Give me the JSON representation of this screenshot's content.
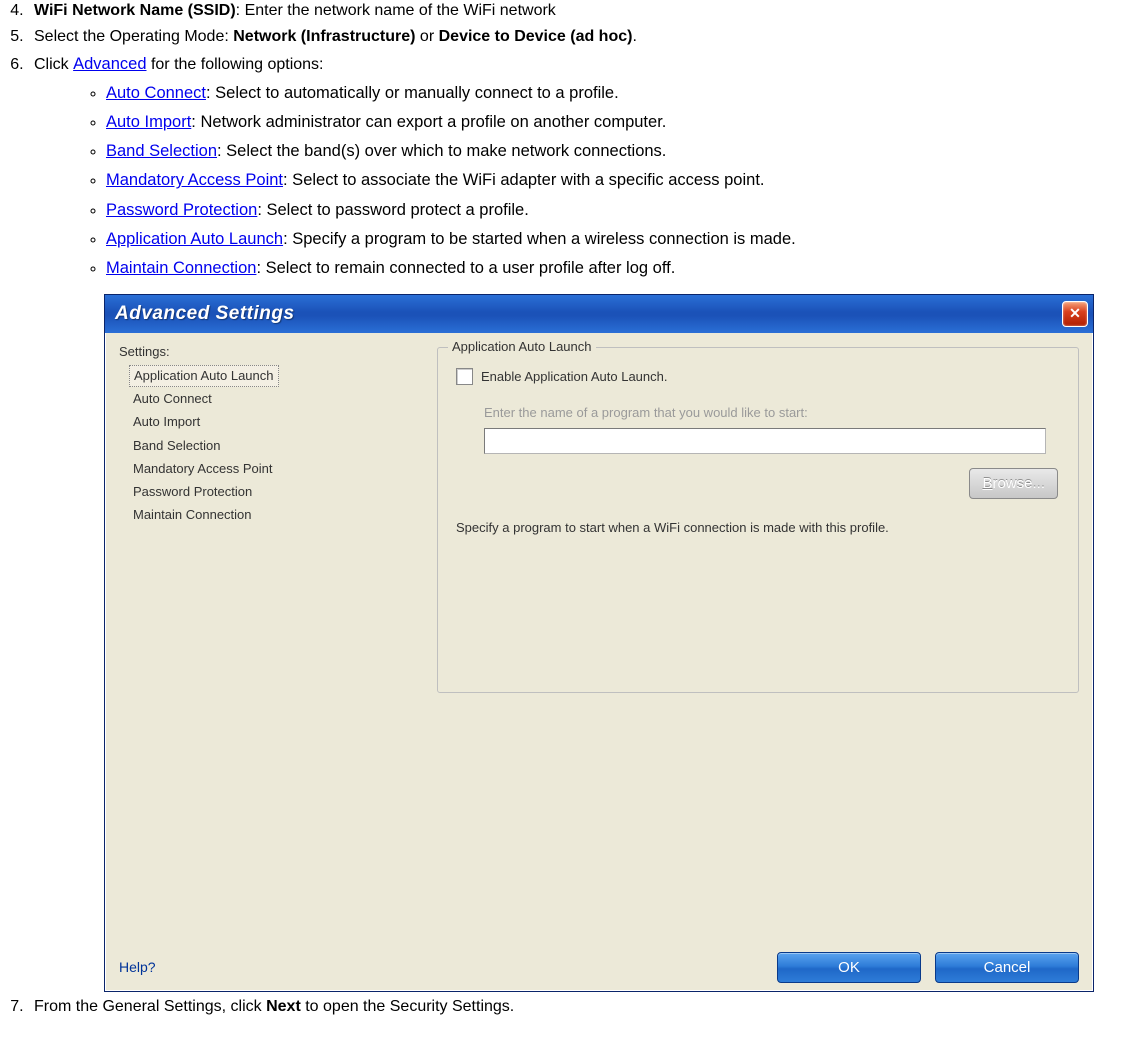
{
  "list": {
    "item4": {
      "bold": "WiFi Network Name (SSID)",
      "rest": ": Enter the network name of the WiFi network"
    },
    "item5": {
      "pre": "Select the Operating Mode: ",
      "b1": "Network (Infrastructure)",
      "mid": " or ",
      "b2": "Device to Device (ad hoc)",
      "post": "."
    },
    "item6": {
      "pre": "Click ",
      "link": "Advanced",
      "post": " for the following options:"
    },
    "sub": [
      {
        "link": "Auto Connect",
        "rest": ": Select to automatically or manually connect to a profile."
      },
      {
        "link": "Auto Import",
        "rest": ": Network administrator can export a profile on another computer."
      },
      {
        "link": "Band Selection",
        "rest": ": Select the band(s) over which to make network connections."
      },
      {
        "link": "Mandatory Access Point",
        "rest": ": Select to associate the WiFi adapter with a specific access point."
      },
      {
        "link": "Password Protection",
        "rest": ": Select to password protect a profile."
      },
      {
        "link": "Application Auto Launch",
        "rest": ": Specify a program to be started when a wireless connection is made."
      },
      {
        "link": "Maintain Connection",
        "rest": ": Select to remain connected to a user profile after log off."
      }
    ],
    "item7": {
      "pre": "From the General Settings, click ",
      "bold": "Next",
      "post": " to open the Security Settings."
    }
  },
  "dialog": {
    "title": "Advanced Settings",
    "settings_label": "Settings:",
    "settings_items": [
      "Application Auto Launch",
      "Auto Connect",
      "Auto Import",
      "Band Selection",
      "Mandatory Access Point",
      "Password Protection",
      "Maintain Connection"
    ],
    "group_title": "Application Auto Launch",
    "checkbox_label": "Enable Application Auto Launch.",
    "gray_label": "Enter the name of a program that you would like to start:",
    "browse": "Browse...",
    "description": "Specify a program to start when a WiFi connection is made with this profile.",
    "help": "Help?",
    "ok": "OK",
    "cancel": "Cancel"
  }
}
